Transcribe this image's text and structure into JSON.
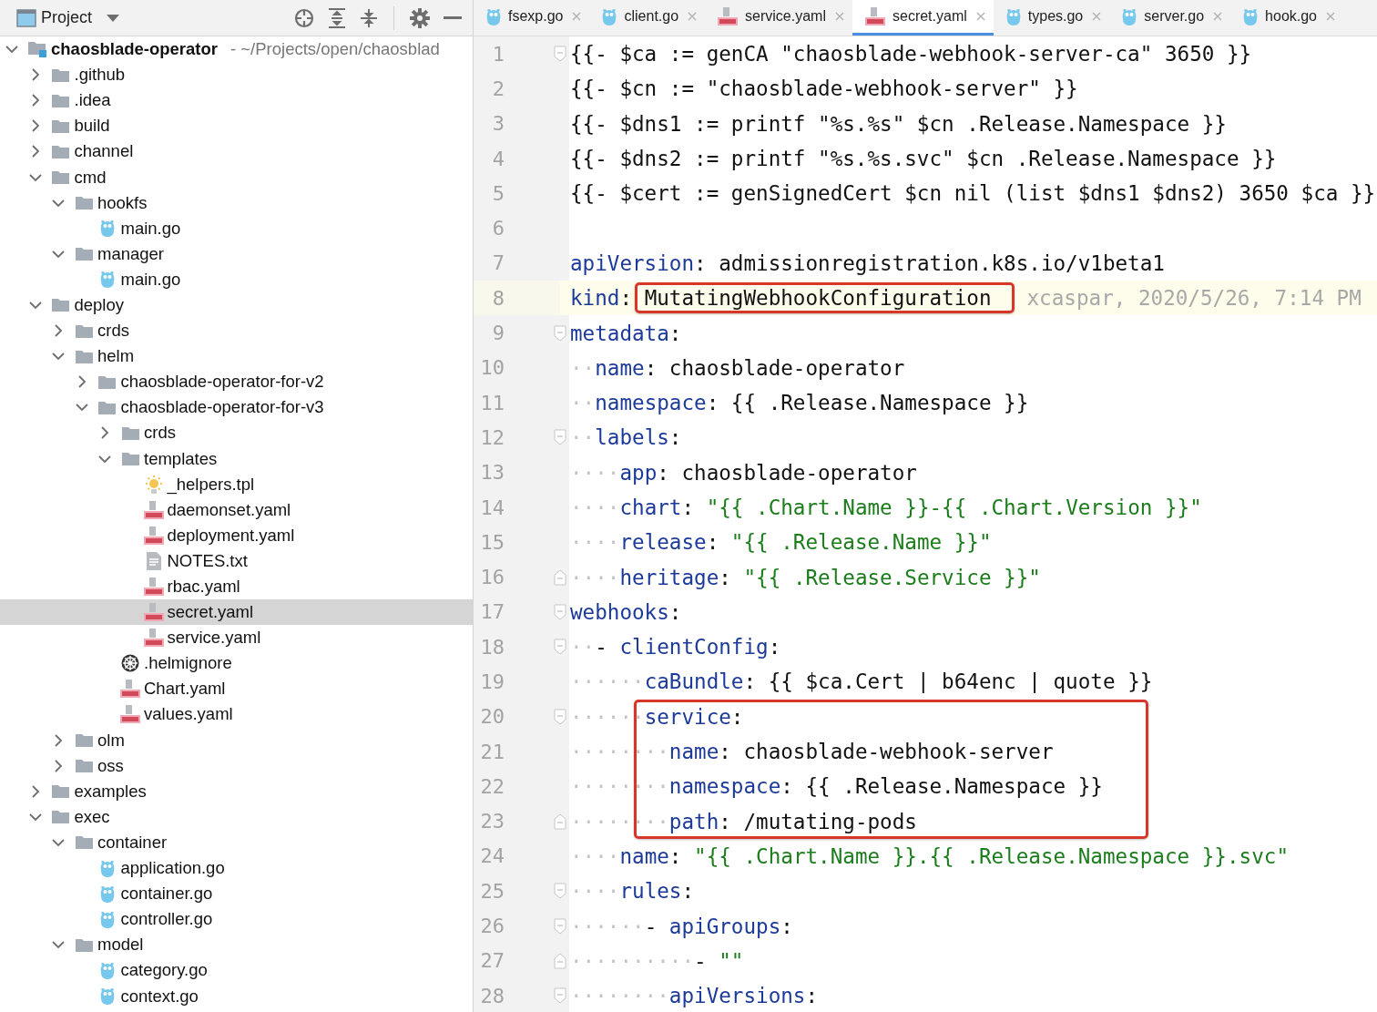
{
  "project_panel": {
    "title": "Project",
    "tree": [
      {
        "name": "chaosblade-operator",
        "path": "- ~/Projects/open/chaosblad",
        "kind": "module",
        "expanded": true,
        "selected": false,
        "children": [
          {
            "name": ".github",
            "kind": "folder",
            "expanded": false,
            "selected": false
          },
          {
            "name": ".idea",
            "kind": "folder",
            "expanded": false,
            "selected": false
          },
          {
            "name": "build",
            "kind": "folder",
            "expanded": false,
            "selected": false
          },
          {
            "name": "channel",
            "kind": "folder",
            "expanded": false,
            "selected": false
          },
          {
            "name": "cmd",
            "kind": "folder",
            "expanded": true,
            "selected": false,
            "children": [
              {
                "name": "hookfs",
                "kind": "folder",
                "expanded": true,
                "selected": false,
                "children": [
                  {
                    "name": "main.go",
                    "kind": "go",
                    "selected": false
                  }
                ]
              },
              {
                "name": "manager",
                "kind": "folder",
                "expanded": true,
                "selected": false,
                "children": [
                  {
                    "name": "main.go",
                    "kind": "go",
                    "selected": false
                  }
                ]
              }
            ]
          },
          {
            "name": "deploy",
            "kind": "folder",
            "expanded": true,
            "selected": false,
            "children": [
              {
                "name": "crds",
                "kind": "folder",
                "expanded": false,
                "selected": false
              },
              {
                "name": "helm",
                "kind": "folder",
                "expanded": true,
                "selected": false,
                "children": [
                  {
                    "name": "chaosblade-operator-for-v2",
                    "kind": "folder",
                    "expanded": false,
                    "selected": false
                  },
                  {
                    "name": "chaosblade-operator-for-v3",
                    "kind": "folder",
                    "expanded": true,
                    "selected": false,
                    "children": [
                      {
                        "name": "crds",
                        "kind": "folder",
                        "expanded": false,
                        "selected": false
                      },
                      {
                        "name": "templates",
                        "kind": "folder",
                        "expanded": true,
                        "selected": false,
                        "children": [
                          {
                            "name": "_helpers.tpl",
                            "kind": "tpl",
                            "selected": false
                          },
                          {
                            "name": "daemonset.yaml",
                            "kind": "yaml",
                            "selected": false
                          },
                          {
                            "name": "deployment.yaml",
                            "kind": "yaml",
                            "selected": false
                          },
                          {
                            "name": "NOTES.txt",
                            "kind": "txt",
                            "selected": false
                          },
                          {
                            "name": "rbac.yaml",
                            "kind": "yaml",
                            "selected": false
                          },
                          {
                            "name": "secret.yaml",
                            "kind": "yaml",
                            "selected": true
                          },
                          {
                            "name": "service.yaml",
                            "kind": "yaml",
                            "selected": false
                          }
                        ]
                      },
                      {
                        "name": ".helmignore",
                        "kind": "helm",
                        "selected": false
                      },
                      {
                        "name": "Chart.yaml",
                        "kind": "yaml",
                        "selected": false
                      },
                      {
                        "name": "values.yaml",
                        "kind": "yaml",
                        "selected": false
                      }
                    ]
                  }
                ]
              },
              {
                "name": "olm",
                "kind": "folder",
                "expanded": false,
                "selected": false
              },
              {
                "name": "oss",
                "kind": "folder",
                "expanded": false,
                "selected": false
              }
            ]
          },
          {
            "name": "examples",
            "kind": "folder",
            "expanded": false,
            "selected": false
          },
          {
            "name": "exec",
            "kind": "folder",
            "expanded": true,
            "selected": false,
            "children": [
              {
                "name": "container",
                "kind": "folder",
                "expanded": true,
                "selected": false,
                "children": [
                  {
                    "name": "application.go",
                    "kind": "go",
                    "selected": false
                  },
                  {
                    "name": "container.go",
                    "kind": "go",
                    "selected": false
                  },
                  {
                    "name": "controller.go",
                    "kind": "go",
                    "selected": false
                  }
                ]
              },
              {
                "name": "model",
                "kind": "folder",
                "expanded": true,
                "selected": false,
                "children": [
                  {
                    "name": "category.go",
                    "kind": "go",
                    "selected": false
                  },
                  {
                    "name": "context.go",
                    "kind": "go",
                    "selected": false
                  }
                ]
              }
            ]
          }
        ]
      }
    ]
  },
  "editor": {
    "tabs": [
      {
        "label": "fsexp.go",
        "kind": "go",
        "selected": false
      },
      {
        "label": "client.go",
        "kind": "go",
        "selected": false
      },
      {
        "label": "service.yaml",
        "kind": "yaml",
        "selected": false
      },
      {
        "label": "secret.yaml",
        "kind": "yaml",
        "selected": true
      },
      {
        "label": "types.go",
        "kind": "go",
        "selected": false
      },
      {
        "label": "server.go",
        "kind": "go",
        "selected": false
      },
      {
        "label": "hook.go",
        "kind": "go",
        "selected": false
      }
    ],
    "lines": [
      {
        "number": "1",
        "current": false,
        "fold": {
          "kind": "start"
        },
        "segments": [
          {
            "kind": "plain",
            "text": "{{- $ca := genCA \"chaosblade-webhook-server-ca\" 3650 }}"
          }
        ]
      },
      {
        "number": "2",
        "current": false,
        "segments": [
          {
            "kind": "plain",
            "text": "{{- $cn := \"chaosblade-webhook-server\" }}"
          }
        ]
      },
      {
        "number": "3",
        "current": false,
        "segments": [
          {
            "kind": "plain",
            "text": "{{- $dns1 := printf \"%s.%s\" $cn .Release.Namespace }}"
          }
        ]
      },
      {
        "number": "4",
        "current": false,
        "segments": [
          {
            "kind": "plain",
            "text": "{{- $dns2 := printf \"%s.%s.svc\" $cn .Release.Namespace }}"
          }
        ]
      },
      {
        "number": "5",
        "current": false,
        "segments": [
          {
            "kind": "plain",
            "text": "{{- $cert := genSignedCert $cn nil (list $dns1 $dns2) 3650 $ca }}"
          }
        ]
      },
      {
        "number": "6",
        "current": false
      },
      {
        "number": "7",
        "current": false,
        "segments": [
          {
            "kind": "key",
            "text": "apiVersion"
          },
          {
            "kind": "plain",
            "text": ": admissionregistration.k8s.io/v1beta1"
          }
        ]
      },
      {
        "number": "8",
        "current": true,
        "segments": [
          {
            "kind": "key",
            "text": "kind"
          },
          {
            "kind": "plain",
            "text": ": "
          },
          {
            "kind": "plain",
            "text": "MutatingWebhookConfiguration",
            "boxed": true
          }
        ],
        "annotation": "xcaspar, 2020/5/26, 7:14 PM"
      },
      {
        "number": "9",
        "current": false,
        "fold": {
          "kind": "start"
        },
        "segments": [
          {
            "kind": "key",
            "text": "metadata"
          },
          {
            "kind": "plain",
            "text": ":"
          }
        ]
      },
      {
        "number": "10",
        "current": false,
        "segments": [
          {
            "kind": "indent",
            "text": "··"
          },
          {
            "kind": "key",
            "text": "name"
          },
          {
            "kind": "plain",
            "text": ": chaosblade-operator"
          }
        ]
      },
      {
        "number": "11",
        "current": false,
        "segments": [
          {
            "kind": "indent",
            "text": "··"
          },
          {
            "kind": "key",
            "text": "namespace"
          },
          {
            "kind": "plain",
            "text": ": {{ .Release.Namespace }}"
          }
        ]
      },
      {
        "number": "12",
        "current": false,
        "fold": {
          "kind": "start"
        },
        "segments": [
          {
            "kind": "indent",
            "text": "··"
          },
          {
            "kind": "key",
            "text": "labels"
          },
          {
            "kind": "plain",
            "text": ":"
          }
        ]
      },
      {
        "number": "13",
        "current": false,
        "segments": [
          {
            "kind": "indent",
            "text": "····"
          },
          {
            "kind": "key",
            "text": "app"
          },
          {
            "kind": "plain",
            "text": ": chaosblade-operator"
          }
        ]
      },
      {
        "number": "14",
        "current": false,
        "segments": [
          {
            "kind": "indent",
            "text": "····"
          },
          {
            "kind": "key",
            "text": "chart"
          },
          {
            "kind": "plain",
            "text": ": "
          },
          {
            "kind": "string",
            "text": "\"{{ .Chart.Name }}-{{ .Chart.Version }}\""
          }
        ]
      },
      {
        "number": "15",
        "current": false,
        "segments": [
          {
            "kind": "indent",
            "text": "····"
          },
          {
            "kind": "key",
            "text": "release"
          },
          {
            "kind": "plain",
            "text": ": "
          },
          {
            "kind": "string",
            "text": "\"{{ .Release.Name }}\""
          }
        ]
      },
      {
        "number": "16",
        "current": false,
        "fold": {
          "kind": "end"
        },
        "segments": [
          {
            "kind": "indent",
            "text": "····"
          },
          {
            "kind": "key",
            "text": "heritage"
          },
          {
            "kind": "plain",
            "text": ": "
          },
          {
            "kind": "string",
            "text": "\"{{ .Release.Service }}\""
          }
        ]
      },
      {
        "number": "17",
        "current": false,
        "fold": {
          "kind": "start"
        },
        "segments": [
          {
            "kind": "key",
            "text": "webhooks"
          },
          {
            "kind": "plain",
            "text": ":"
          }
        ]
      },
      {
        "number": "18",
        "current": false,
        "fold": {
          "kind": "start"
        },
        "segments": [
          {
            "kind": "indent",
            "text": "··"
          },
          {
            "kind": "plain",
            "text": "- "
          },
          {
            "kind": "key",
            "text": "clientConfig"
          },
          {
            "kind": "plain",
            "text": ":"
          }
        ]
      },
      {
        "number": "19",
        "current": false,
        "segments": [
          {
            "kind": "indent",
            "text": "······"
          },
          {
            "kind": "key",
            "text": "caBundle"
          },
          {
            "kind": "plain",
            "text": ": {{ $ca.Cert | b64enc | quote }}"
          }
        ]
      },
      {
        "number": "20",
        "current": false,
        "fold": {
          "kind": "start"
        },
        "segments": [
          {
            "kind": "indent",
            "text": "······"
          },
          {
            "kind": "key",
            "text": "service",
            "boxed": true
          },
          {
            "kind": "plain",
            "text": ":",
            "boxed": true
          }
        ]
      },
      {
        "number": "21",
        "current": false,
        "segments": [
          {
            "kind": "indent",
            "text": "········"
          },
          {
            "kind": "key",
            "text": "name",
            "boxed": true
          },
          {
            "kind": "plain",
            "text": ": chaosblade-webhook-server",
            "boxed": true
          }
        ]
      },
      {
        "number": "22",
        "current": false,
        "segments": [
          {
            "kind": "indent",
            "text": "········"
          },
          {
            "kind": "key",
            "text": "namespace",
            "boxed": true
          },
          {
            "kind": "plain",
            "text": ": {{ .Release.Namespace }}",
            "boxed": true
          }
        ]
      },
      {
        "number": "23",
        "current": false,
        "fold": {
          "kind": "end"
        },
        "segments": [
          {
            "kind": "indent",
            "text": "········"
          },
          {
            "kind": "key",
            "text": "path",
            "boxed": true
          },
          {
            "kind": "plain",
            "text": ": /mutating-pods",
            "boxed": true
          }
        ]
      },
      {
        "number": "24",
        "current": false,
        "segments": [
          {
            "kind": "indent",
            "text": "····"
          },
          {
            "kind": "key",
            "text": "name"
          },
          {
            "kind": "plain",
            "text": ": "
          },
          {
            "kind": "string",
            "text": "\"{{ .Chart.Name }}.{{ .Release.Namespace }}.svc\""
          }
        ]
      },
      {
        "number": "25",
        "current": false,
        "fold": {
          "kind": "start"
        },
        "segments": [
          {
            "kind": "indent",
            "text": "····"
          },
          {
            "kind": "key",
            "text": "rules"
          },
          {
            "kind": "plain",
            "text": ":"
          }
        ]
      },
      {
        "number": "26",
        "current": false,
        "fold": {
          "kind": "start"
        },
        "segments": [
          {
            "kind": "indent",
            "text": "······"
          },
          {
            "kind": "plain",
            "text": "- "
          },
          {
            "kind": "key",
            "text": "apiGroups"
          },
          {
            "kind": "plain",
            "text": ":"
          }
        ]
      },
      {
        "number": "27",
        "current": false,
        "fold": {
          "kind": "end"
        },
        "segments": [
          {
            "kind": "indent",
            "text": "··········"
          },
          {
            "kind": "plain",
            "text": "- "
          },
          {
            "kind": "string",
            "text": "\"\""
          }
        ]
      },
      {
        "number": "28",
        "current": false,
        "fold": {
          "kind": "start"
        },
        "segments": [
          {
            "kind": "indent",
            "text": "········"
          },
          {
            "kind": "key",
            "text": "apiVersions"
          },
          {
            "kind": "plain",
            "text": ":"
          }
        ]
      }
    ]
  }
}
